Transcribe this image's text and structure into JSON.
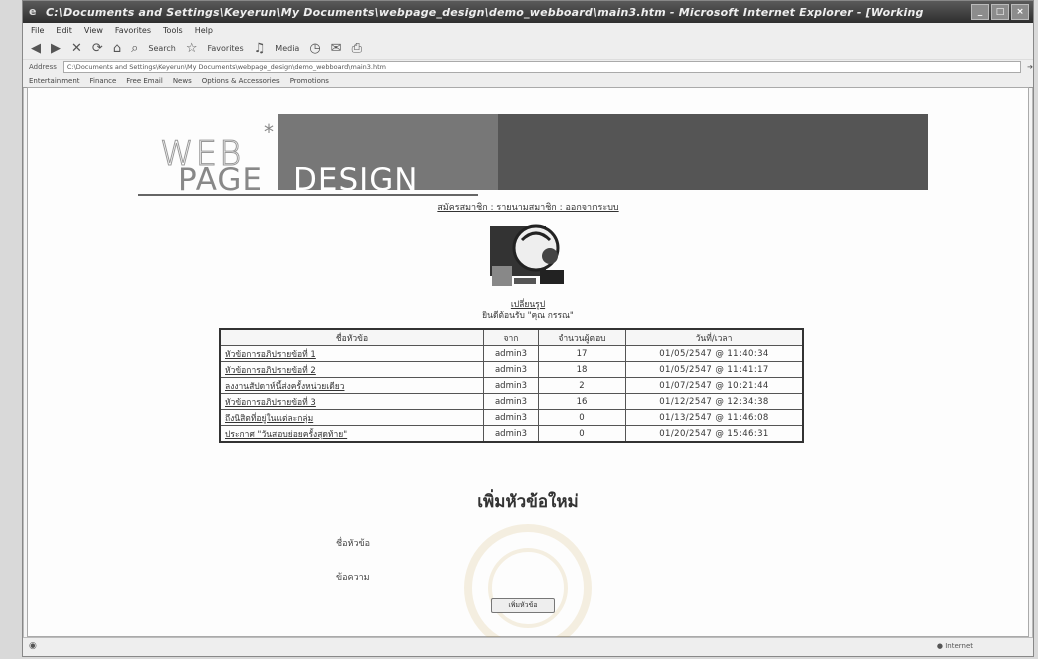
{
  "window": {
    "title": "C:\\Documents and Settings\\Keyerun\\My Documents\\webpage_design\\demo_webboard\\main3.htm - Microsoft Internet Explorer - [Working",
    "controls": [
      "_",
      "□",
      "×"
    ]
  },
  "menu": [
    "File",
    "Edit",
    "View",
    "Favorites",
    "Tools",
    "Help"
  ],
  "toolbar": {
    "back": "◀",
    "forward": "▶",
    "search_label": "Search",
    "favorites_label": "Favorites",
    "media_label": "Media"
  },
  "address": {
    "label": "Address",
    "value": "C:\\Documents and Settings\\Keyerun\\My Documents\\webpage_design\\demo_webboard\\main3.htm"
  },
  "links": [
    "Entertainment",
    "Finance",
    "Free Email",
    "News",
    "Options & Accessories",
    "Promotions"
  ],
  "banner": {
    "web": "WEB",
    "page": "PAGE",
    "design": "DESIGN"
  },
  "nav_links": "สมัครสมาชิก : รายนามสมาชิก : ออกจากระบบ",
  "welcome": {
    "line1": "เปลี่ยนรูป",
    "line2": "ยินดีต้อนรับ \"คุณ กรรณ\""
  },
  "board": {
    "headers": [
      "ชื่อหัวข้อ",
      "จาก",
      "จำนวนผู้ตอบ",
      "วันที่/เวลา"
    ],
    "rows": [
      {
        "topic": "หัวข้อการอภิปรายข้อที่ 1",
        "from": "admin3",
        "count": "17",
        "date": "01/05/2547 @ 11:40:34"
      },
      {
        "topic": "หัวข้อการอภิปรายข้อที่ 2",
        "from": "admin3",
        "count": "18",
        "date": "01/05/2547 @ 11:41:17"
      },
      {
        "topic": "ลงงานสัปดาห์นี้ส่งครั้งหน่วยเดียว",
        "from": "admin3",
        "count": "2",
        "date": "01/07/2547 @ 10:21:44"
      },
      {
        "topic": "หัวข้อการอภิปรายข้อที่ 3",
        "from": "admin3",
        "count": "16",
        "date": "01/12/2547 @ 12:34:38"
      },
      {
        "topic": "ถึงนิสิตที่อยู่ในแต่ละกลุ่ม",
        "from": "admin3",
        "count": "0",
        "date": "01/13/2547 @ 11:46:08"
      },
      {
        "topic": "ประกาศ \"วันสอบย่อยครั้งสุดท้าย\"",
        "from": "admin3",
        "count": "0",
        "date": "01/20/2547 @ 15:46:31"
      }
    ]
  },
  "form": {
    "title": "เพิ่มหัวข้อใหม่",
    "topic_label": "ชื่อหัวข้อ",
    "message_label": "ข้อความ",
    "submit_label": "เพิ่มหัวข้อ"
  },
  "status": {
    "zone": "Internet"
  }
}
